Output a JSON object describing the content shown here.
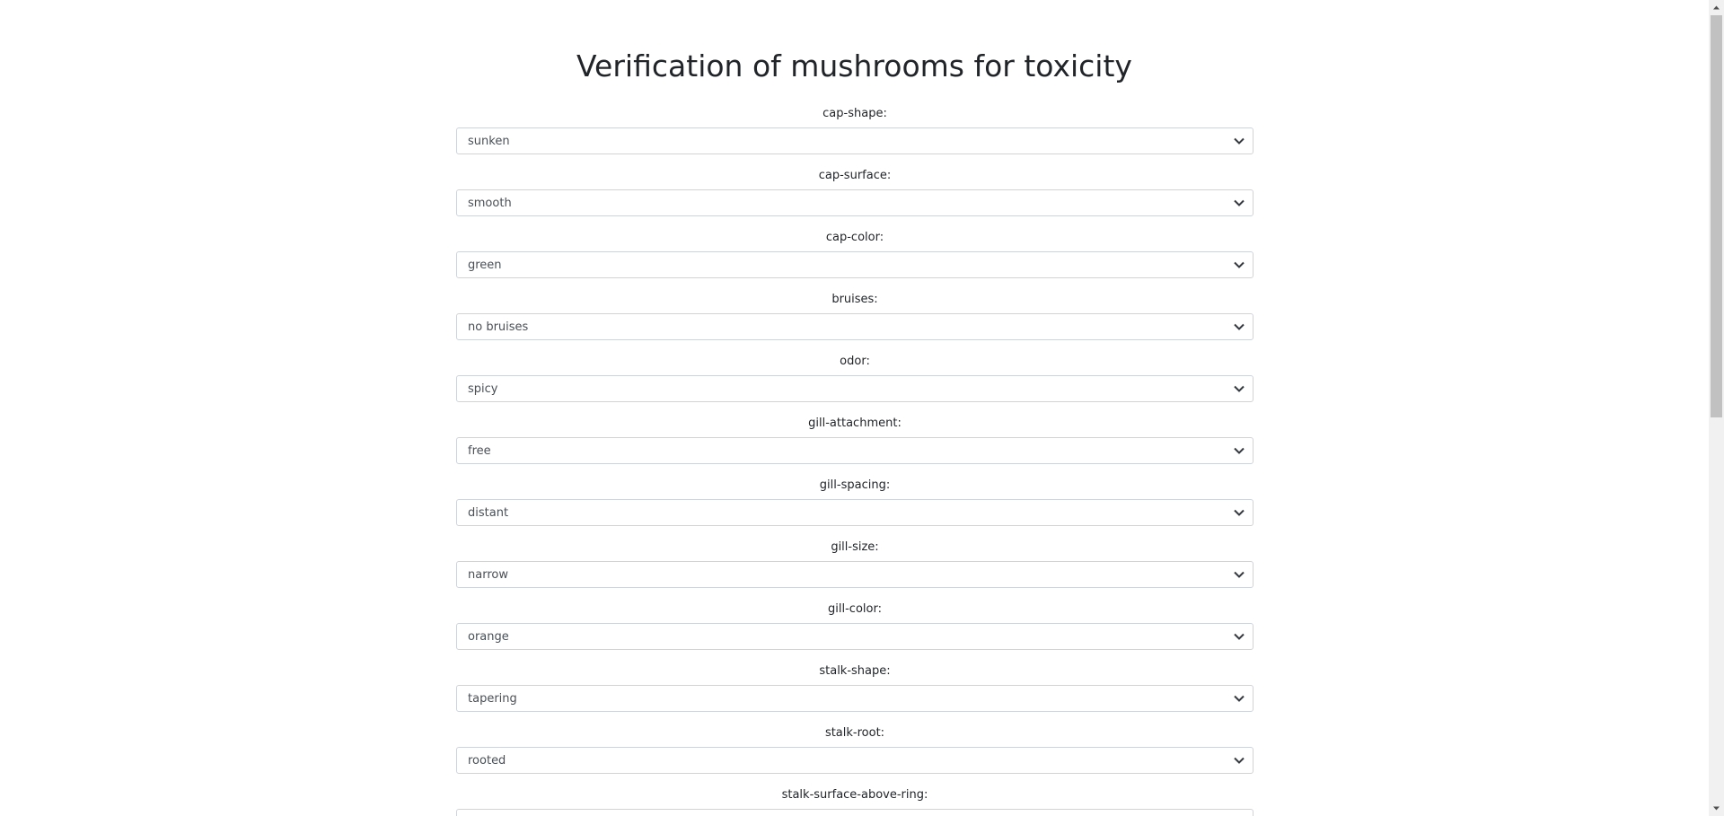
{
  "page": {
    "title": "Verification of mushrooms for toxicity"
  },
  "fields": [
    {
      "label": "cap-shape:",
      "value": "sunken"
    },
    {
      "label": "cap-surface:",
      "value": "smooth"
    },
    {
      "label": "cap-color:",
      "value": "green"
    },
    {
      "label": "bruises:",
      "value": "no bruises"
    },
    {
      "label": "odor:",
      "value": "spicy"
    },
    {
      "label": "gill-attachment:",
      "value": "free"
    },
    {
      "label": "gill-spacing:",
      "value": "distant"
    },
    {
      "label": "gill-size:",
      "value": "narrow"
    },
    {
      "label": "gill-color:",
      "value": "orange"
    },
    {
      "label": "stalk-shape:",
      "value": "tapering"
    },
    {
      "label": "stalk-root:",
      "value": "rooted"
    },
    {
      "label": "stalk-surface-above-ring:",
      "value": ""
    }
  ],
  "icons": {
    "select_chevron": "chevron-down-icon",
    "scroll_up": "triangle-up-icon",
    "scroll_down": "triangle-down-icon"
  },
  "colors": {
    "text": "#212529",
    "select_border": "#ced4da",
    "select_text": "#495057",
    "scroll_track": "#f1f1f1",
    "scroll_thumb": "#c1c1c1"
  }
}
